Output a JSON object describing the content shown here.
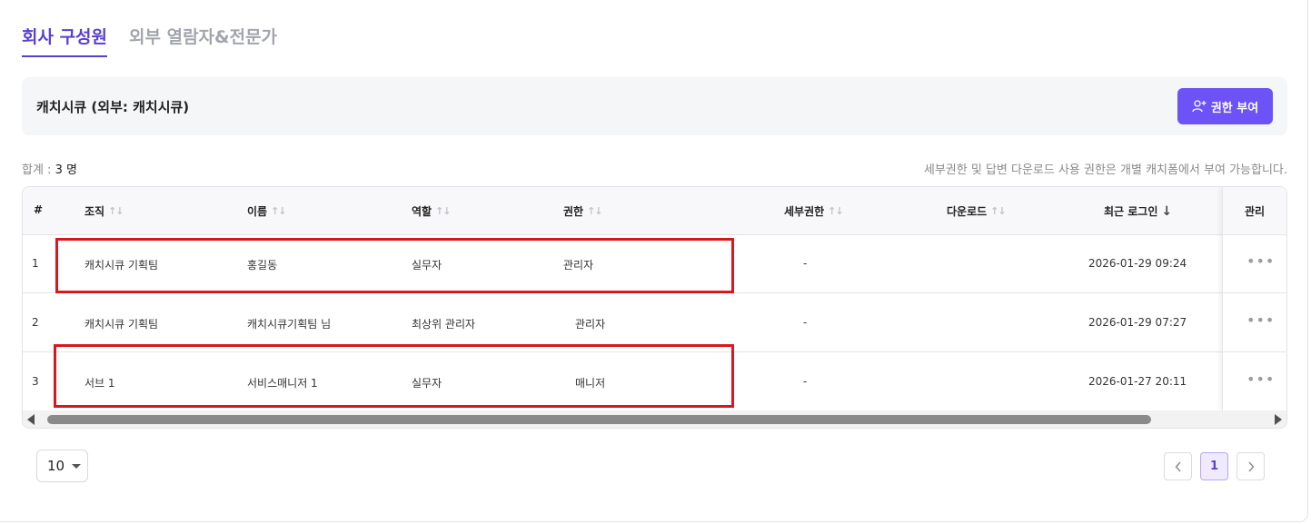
{
  "tabs": [
    {
      "label": "회사 구성원",
      "active": true
    },
    {
      "label": "외부 열람자&전문가",
      "active": false
    }
  ],
  "org": {
    "name": "캐치시큐 (외부: 캐치시큐)",
    "grant_button": "권한 부여"
  },
  "summary": {
    "total_label": "합계 :",
    "total_value": "3 명",
    "note": "세부권한 및 답변 다운로드 사용 권한은 개별 캐치폼에서 부여 가능합니다."
  },
  "table": {
    "headers": {
      "index": "#",
      "org": "조직",
      "name": "이름",
      "role": "역할",
      "permission": "권한",
      "detail_permission": "세부권한",
      "download": "다운로드",
      "last_login": "최근 로그인",
      "manage": "관리"
    },
    "rows": [
      {
        "index": "1",
        "org": "캐치시큐 기획팀",
        "name": "홍길동",
        "role": "실무자",
        "permission": "관리자",
        "detail_permission": "-",
        "download": "",
        "last_login": "2026-01-29 09:24"
      },
      {
        "index": "2",
        "org": "캐치시큐 기획팀",
        "name": "캐치시큐기획팀 님",
        "role": "최상위 관리자",
        "permission": "관리자",
        "detail_permission": "-",
        "download": "",
        "last_login": "2026-01-29 07:27"
      },
      {
        "index": "3",
        "org": "서브 1",
        "name": "서비스매니저 1",
        "role": "실무자",
        "permission": "매니저",
        "detail_permission": "-",
        "download": "",
        "last_login": "2026-01-27 20:11"
      }
    ],
    "row_menu_icon": "more-horizontal-icon"
  },
  "pagination": {
    "per_page": "10",
    "current_page": "1"
  },
  "colors": {
    "accent": "#5b3fd1",
    "button": "#6c52f7",
    "highlight_box": "#d7191f"
  }
}
